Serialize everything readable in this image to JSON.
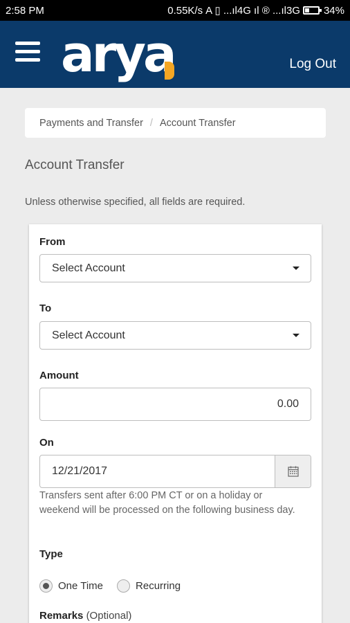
{
  "status": {
    "time": "2:58 PM",
    "net": "0.55K/s",
    "icons": "A ▯ ...ıl4G ıl ® ...ıl3G",
    "battery": "34%",
    "battery_level": 0.34
  },
  "header": {
    "logo": "arya",
    "logout_label": "Log Out"
  },
  "breadcrumb": {
    "items": [
      "Payments and Transfer",
      "Account Transfer"
    ],
    "separator": "/"
  },
  "page": {
    "title": "Account Transfer",
    "instructions": "Unless otherwise specified, all fields are required."
  },
  "form": {
    "from_label": "From",
    "from_value": "Select Account",
    "to_label": "To",
    "to_value": "Select Account",
    "amount_label": "Amount",
    "amount_value": "0.00",
    "on_label": "On",
    "date_value": "12/21/2017",
    "help_text": "Transfers sent after 6:00 PM CT or on a holiday or weekend will be processed on the following business day.",
    "type_label": "Type",
    "type_options": [
      "One Time",
      "Recurring"
    ],
    "type_selected": "One Time",
    "remarks_label": "Remarks",
    "remarks_optional": "(Optional)"
  },
  "icons": {
    "menu": "hamburger-icon",
    "calendar": "calendar-icon",
    "dropdown": "caret-down-icon"
  },
  "colors": {
    "appbar": "#0b3a6a",
    "accent": "#f5a623",
    "background": "#ececec"
  }
}
